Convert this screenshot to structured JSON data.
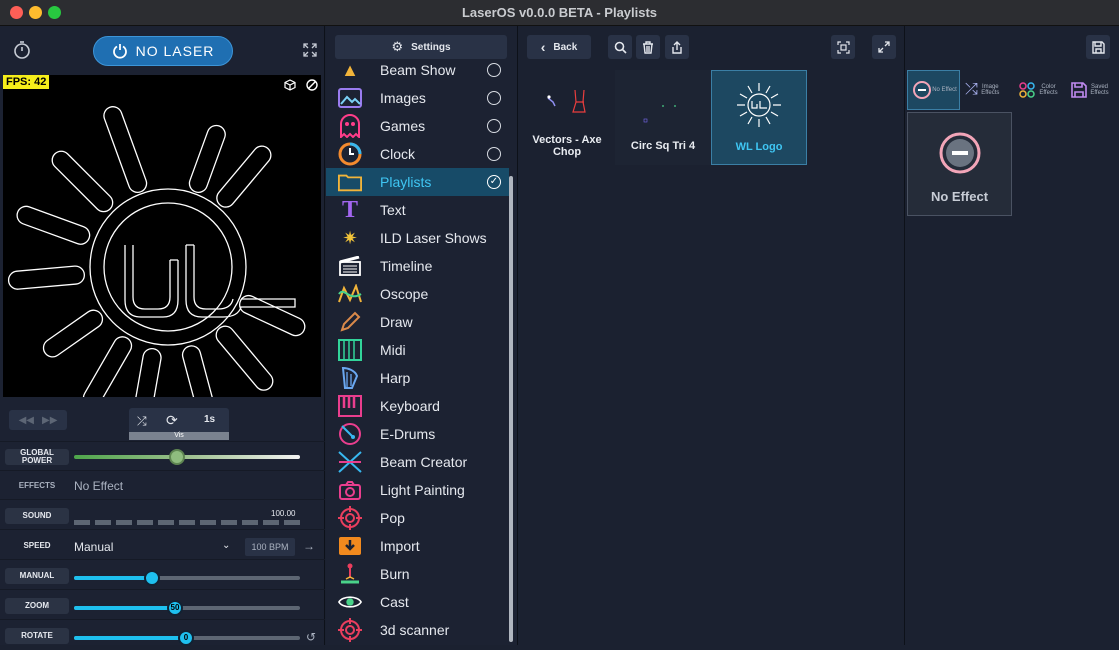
{
  "window": {
    "title": "LaserOS v0.0.0 BETA - Playlists"
  },
  "left": {
    "no_laser_label": "NO LASER",
    "fps_label": "FPS: 42",
    "shuffle_duration": "1s",
    "vis_label": "Vis",
    "controls": {
      "global_power_label": "GLOBAL POWER",
      "global_power_value": 0.45,
      "effects_label": "EFFECTS",
      "effects_value": "No Effect",
      "sound_label": "SOUND",
      "sound_value": "100.00",
      "speed_label": "SPEED",
      "speed_mode": "Manual",
      "speed_bpm": "100 BPM",
      "manual_label": "MANUAL",
      "manual_value": 0.34,
      "zoom_label": "ZOOM",
      "zoom_value": "50",
      "rotate_label": "ROTATE",
      "rotate_value": "0"
    }
  },
  "menu": {
    "settings_label": "Settings",
    "items": [
      {
        "label": "Beam Show",
        "icon": "beam-show-icon",
        "radio": true,
        "active": false
      },
      {
        "label": "Images",
        "icon": "images-icon",
        "radio": true,
        "active": false
      },
      {
        "label": "Games",
        "icon": "games-icon",
        "radio": true,
        "active": false
      },
      {
        "label": "Clock",
        "icon": "clock-icon",
        "radio": true,
        "active": false
      },
      {
        "label": "Playlists",
        "icon": "folder-icon",
        "radio": true,
        "active": true
      },
      {
        "label": "Text",
        "icon": "text-icon",
        "radio": false,
        "active": false
      },
      {
        "label": "ILD Laser Shows",
        "icon": "ild-icon",
        "radio": false,
        "active": false
      },
      {
        "label": "Timeline",
        "icon": "timeline-icon",
        "radio": false,
        "active": false
      },
      {
        "label": "Oscope",
        "icon": "oscope-icon",
        "radio": false,
        "active": false
      },
      {
        "label": "Draw",
        "icon": "pencil-icon",
        "radio": false,
        "active": false
      },
      {
        "label": "Midi",
        "icon": "midi-icon",
        "radio": false,
        "active": false
      },
      {
        "label": "Harp",
        "icon": "harp-icon",
        "radio": false,
        "active": false
      },
      {
        "label": "Keyboard",
        "icon": "keyboard-icon",
        "radio": false,
        "active": false
      },
      {
        "label": "E-Drums",
        "icon": "drum-icon",
        "radio": false,
        "active": false
      },
      {
        "label": "Beam Creator",
        "icon": "beam-creator-icon",
        "radio": false,
        "active": false
      },
      {
        "label": "Light Painting",
        "icon": "camera-icon",
        "radio": false,
        "active": false
      },
      {
        "label": "Pop",
        "icon": "target-icon",
        "radio": false,
        "active": false
      },
      {
        "label": "Import",
        "icon": "import-icon",
        "radio": false,
        "active": false
      },
      {
        "label": "Burn",
        "icon": "burn-icon",
        "radio": false,
        "active": false
      },
      {
        "label": "Cast",
        "icon": "eye-icon",
        "radio": false,
        "active": false
      },
      {
        "label": "3d scanner",
        "icon": "scanner-icon",
        "radio": false,
        "active": false
      }
    ]
  },
  "center": {
    "back_label": "Back",
    "cards": [
      {
        "label": "Vectors - Axe Chop",
        "selected": false
      },
      {
        "label": "Circ Sq Tri 4",
        "selected": false
      },
      {
        "label": "WL Logo",
        "selected": true
      }
    ]
  },
  "effects_panel": {
    "tabs": [
      {
        "label": "No Effect",
        "icon": "no-effect-icon",
        "active": true
      },
      {
        "label": "Image Effects",
        "icon": "shuffle-icon",
        "active": false
      },
      {
        "label": "Color Effects",
        "icon": "color-dots-icon",
        "active": false
      },
      {
        "label": "Saved Effects",
        "icon": "save-icon",
        "active": false
      }
    ],
    "selected_effect": "No Effect"
  },
  "colors": {
    "accent": "#1ec0ef",
    "active_bg": "#174b68",
    "fps_bg": "#f6ee1a"
  }
}
